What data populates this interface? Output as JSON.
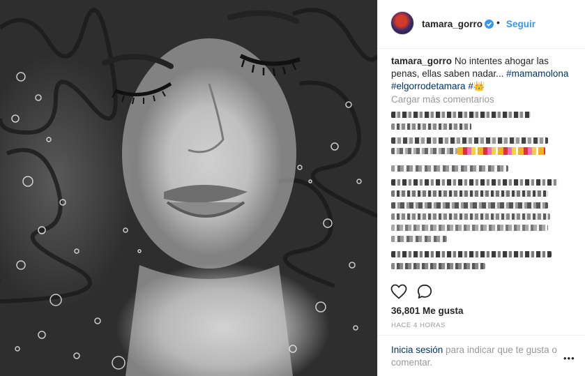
{
  "post": {
    "username": "tamara_gorro",
    "follow_label": "Seguir",
    "dot": "•",
    "caption_text": "No intentes ahogar las penas, ellas saben nadar...",
    "caption_tags": "#mamamolona #elgorrodetamara #",
    "caption_emoji": "👑",
    "load_more_label": "Cargar más comentarios",
    "likes": "36,801 Me gusta",
    "time": "HACE 4 HORAS",
    "login_link": "Inicia sesión",
    "login_rest": " para indicar que te gusta o comentar.",
    "more_label": "•••"
  },
  "icons": {
    "avatar": "avatar",
    "verified": "verified-badge-icon",
    "heart": "heart-icon",
    "comment": "comment-icon",
    "more": "more-options-icon"
  },
  "colors": {
    "link_blue": "#3897f0",
    "hashtag": "#003569",
    "muted": "#999999",
    "text": "#262626"
  }
}
